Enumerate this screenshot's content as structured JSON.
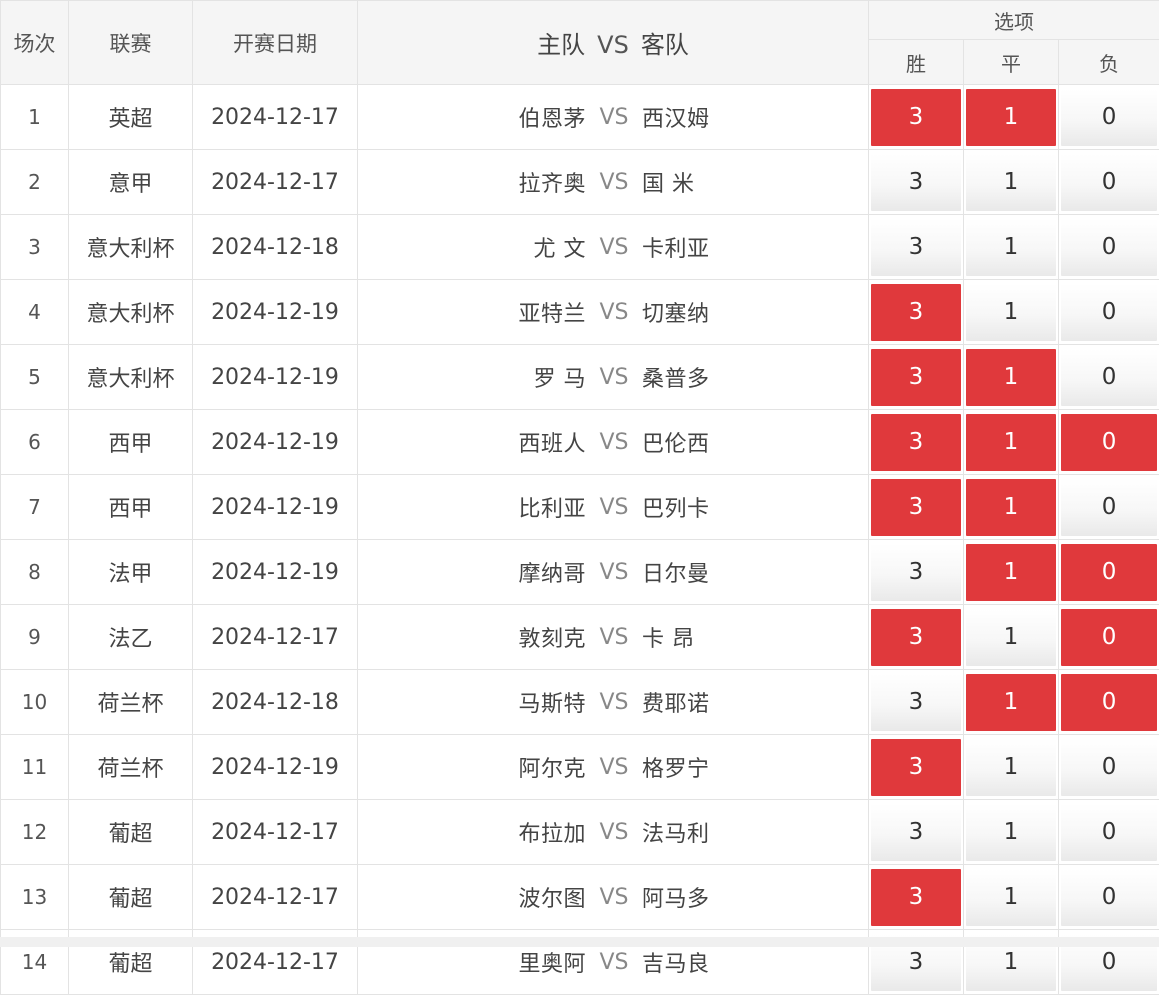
{
  "header": {
    "col_index": "场次",
    "col_league": "联赛",
    "col_date": "开赛日期",
    "col_home": "主队",
    "col_vs": "VS",
    "col_away": "客队",
    "options": "选项",
    "win": "胜",
    "draw": "平",
    "lose": "负"
  },
  "vs_label": "VS",
  "colors": {
    "selected": "#e0393c",
    "header_bg": "#f5f5f5"
  },
  "rows": [
    {
      "idx": "1",
      "league": "英超",
      "date": "2024-12-17",
      "home": "伯恩茅",
      "away": "西汉姆",
      "w": "3",
      "d": "1",
      "l": "0",
      "ws": true,
      "ds": true,
      "ls": false
    },
    {
      "idx": "2",
      "league": "意甲",
      "date": "2024-12-17",
      "home": "拉齐奥",
      "away": "国 米",
      "w": "3",
      "d": "1",
      "l": "0",
      "ws": false,
      "ds": false,
      "ls": false
    },
    {
      "idx": "3",
      "league": "意大利杯",
      "date": "2024-12-18",
      "home": "尤 文",
      "away": "卡利亚",
      "w": "3",
      "d": "1",
      "l": "0",
      "ws": false,
      "ds": false,
      "ls": false
    },
    {
      "idx": "4",
      "league": "意大利杯",
      "date": "2024-12-19",
      "home": "亚特兰",
      "away": "切塞纳",
      "w": "3",
      "d": "1",
      "l": "0",
      "ws": true,
      "ds": false,
      "ls": false
    },
    {
      "idx": "5",
      "league": "意大利杯",
      "date": "2024-12-19",
      "home": "罗 马",
      "away": "桑普多",
      "w": "3",
      "d": "1",
      "l": "0",
      "ws": true,
      "ds": true,
      "ls": false
    },
    {
      "idx": "6",
      "league": "西甲",
      "date": "2024-12-19",
      "home": "西班人",
      "away": "巴伦西",
      "w": "3",
      "d": "1",
      "l": "0",
      "ws": true,
      "ds": true,
      "ls": true
    },
    {
      "idx": "7",
      "league": "西甲",
      "date": "2024-12-19",
      "home": "比利亚",
      "away": "巴列卡",
      "w": "3",
      "d": "1",
      "l": "0",
      "ws": true,
      "ds": true,
      "ls": false
    },
    {
      "idx": "8",
      "league": "法甲",
      "date": "2024-12-19",
      "home": "摩纳哥",
      "away": "日尔曼",
      "w": "3",
      "d": "1",
      "l": "0",
      "ws": false,
      "ds": true,
      "ls": true
    },
    {
      "idx": "9",
      "league": "法乙",
      "date": "2024-12-17",
      "home": "敦刻克",
      "away": "卡 昂",
      "w": "3",
      "d": "1",
      "l": "0",
      "ws": true,
      "ds": false,
      "ls": true
    },
    {
      "idx": "10",
      "league": "荷兰杯",
      "date": "2024-12-18",
      "home": "马斯特",
      "away": "费耶诺",
      "w": "3",
      "d": "1",
      "l": "0",
      "ws": false,
      "ds": true,
      "ls": true
    },
    {
      "idx": "11",
      "league": "荷兰杯",
      "date": "2024-12-19",
      "home": "阿尔克",
      "away": "格罗宁",
      "w": "3",
      "d": "1",
      "l": "0",
      "ws": true,
      "ds": false,
      "ls": false
    },
    {
      "idx": "12",
      "league": "葡超",
      "date": "2024-12-17",
      "home": "布拉加",
      "away": "法马利",
      "w": "3",
      "d": "1",
      "l": "0",
      "ws": false,
      "ds": false,
      "ls": false
    },
    {
      "idx": "13",
      "league": "葡超",
      "date": "2024-12-17",
      "home": "波尔图",
      "away": "阿马多",
      "w": "3",
      "d": "1",
      "l": "0",
      "ws": true,
      "ds": false,
      "ls": false
    },
    {
      "idx": "14",
      "league": "葡超",
      "date": "2024-12-17",
      "home": "里奥阿",
      "away": "吉马良",
      "w": "3",
      "d": "1",
      "l": "0",
      "ws": false,
      "ds": false,
      "ls": false
    }
  ]
}
